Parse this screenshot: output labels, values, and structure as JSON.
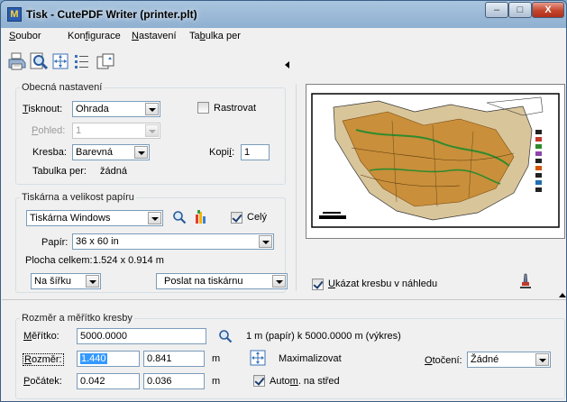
{
  "window": {
    "title": "Tisk - CutePDF Writer  (printer.plt)",
    "buttons": {
      "minimize": "–",
      "maximize": "□",
      "close": "X"
    }
  },
  "menu": [
    {
      "pre": "",
      "u": "S",
      "post": "oubor"
    },
    {
      "pre": "Kon",
      "u": "f",
      "post": "igurace"
    },
    {
      "pre": "",
      "u": "N",
      "post": "astavení"
    },
    {
      "pre": "Ta",
      "u": "b",
      "post": "ulka per"
    }
  ],
  "toolbar": {
    "icons": [
      "printer-icon",
      "print-preview-icon",
      "plot-window-icon",
      "list-icon",
      "copy-icon"
    ]
  },
  "general": {
    "title": "Obecná nastavení",
    "print_label_u": "T",
    "print_label_rest": "isknout:",
    "print_value": "Ohrada",
    "rasterize_label": "Rastrovat",
    "view_label_u": "P",
    "view_label_rest": "ohled:",
    "view_value": "1",
    "drawing_label": "Kresba:",
    "drawing_value": "Barevná",
    "copies_label_pre": "Kopi",
    "copies_label_u": "í",
    "copies_label_post": ":",
    "copies_value": "1",
    "pen_table_label": "Tabulka per:",
    "pen_table_value": "žádná"
  },
  "printer": {
    "title": "Tiskárna a velikost papíru",
    "printer_value": "Tiskárna Windows",
    "whole_label": "Celý",
    "paper_label": "Papír:",
    "paper_value": "36 x 60 in",
    "area_label": "Plocha celkem:",
    "area_value": "1.524 x 0.914 m",
    "orientation_value": "Na šířku",
    "send_value": "Poslat na tiskárnu"
  },
  "show_preview": {
    "u": "U",
    "rest": "kázat kresbu v náhledu"
  },
  "scale": {
    "title": "Rozměr a měřítko kresby",
    "scale_label_u": "M",
    "scale_label_rest": "ěřítko:",
    "scale_value": "5000.0000",
    "scale_text": "1 m (papír) k 5000.0000 m (výkres)",
    "size_label_u": "R",
    "size_label_rest": "ozměr:",
    "size_w": "1.440",
    "size_h": "0.841",
    "unit1": "m",
    "maximize_label": "Maximalizovat",
    "rotation_label_u": "O",
    "rotation_label_rest": "točení:",
    "rotation_value": "Žádné",
    "origin_label_u": "P",
    "origin_label_rest": "očátek:",
    "origin_x": "0.042",
    "origin_y": "0.036",
    "unit2": "m",
    "center_label_pre": "Auto",
    "center_label_u": "m",
    "center_label_post": ". na střed"
  }
}
